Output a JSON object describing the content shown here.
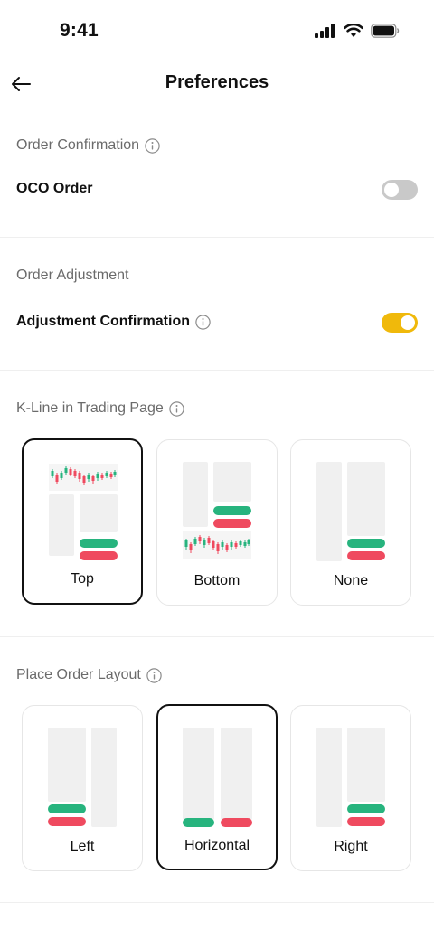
{
  "status_bar": {
    "time": "9:41"
  },
  "header": {
    "title": "Preferences"
  },
  "order_confirmation": {
    "title": "Order Confirmation",
    "oco_label": "OCO Order",
    "oco_enabled": false
  },
  "order_adjustment": {
    "title": "Order Adjustment",
    "adjustment_label": "Adjustment Confirmation",
    "adjustment_enabled": true
  },
  "kline": {
    "title": "K-Line in Trading Page",
    "options": [
      {
        "label": "Top",
        "selected": true
      },
      {
        "label": "Bottom",
        "selected": false
      },
      {
        "label": "None",
        "selected": false
      }
    ]
  },
  "place_order": {
    "title": "Place Order Layout",
    "options": [
      {
        "label": "Left",
        "selected": false
      },
      {
        "label": "Horizontal",
        "selected": true
      },
      {
        "label": "Right",
        "selected": false
      }
    ]
  },
  "colors": {
    "accent": "#f0b90b",
    "buy": "#27b47e",
    "sell": "#ef4a5f"
  }
}
